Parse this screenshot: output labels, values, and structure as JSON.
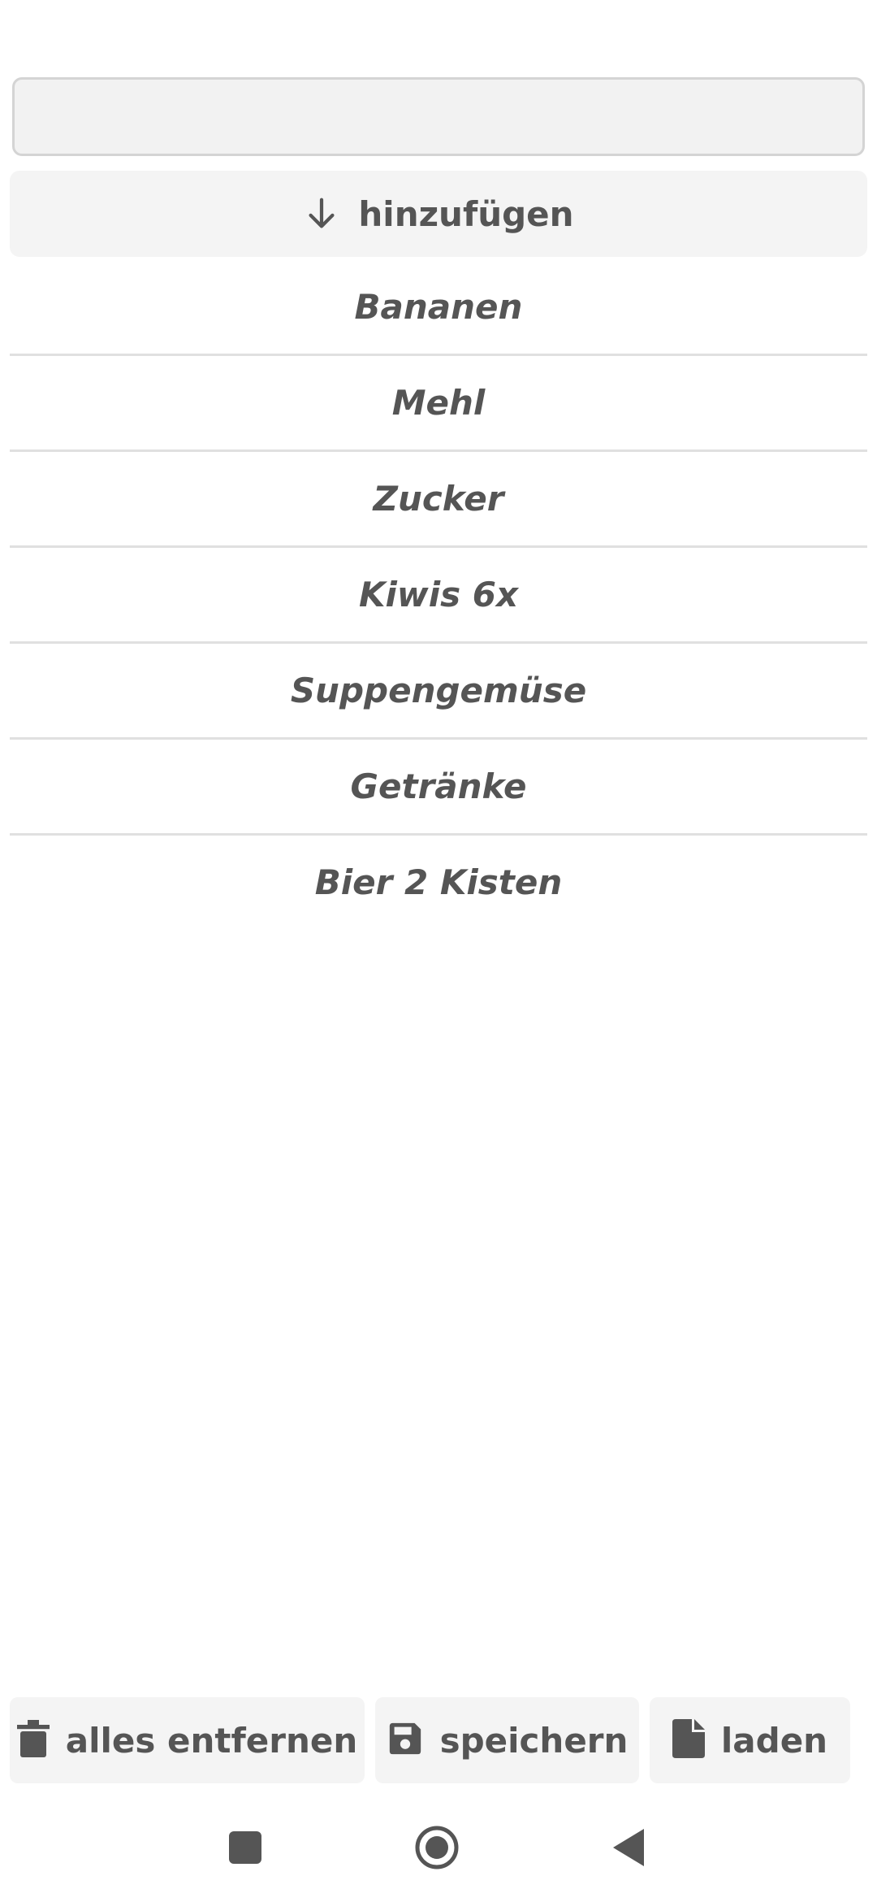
{
  "input": {
    "value": "",
    "placeholder": ""
  },
  "add_button": {
    "label": "hinzufügen",
    "icon": "arrow-down-icon"
  },
  "list": {
    "items": [
      "Bananen",
      "Mehl",
      "Zucker",
      "Kiwis 6x",
      "Suppengemüse",
      "Getränke",
      "Bier 2 Kisten"
    ]
  },
  "bottom_bar": {
    "clear_label": "alles entfernen",
    "clear_icon": "trash-icon",
    "save_label": "speichern",
    "save_icon": "floppy-disk-icon",
    "load_label": "laden",
    "load_icon": "file-icon"
  },
  "nav": {
    "recents_icon": "square-icon",
    "home_icon": "circle-icon",
    "back_icon": "triangle-back-icon"
  },
  "colors": {
    "text": "#555555",
    "button_bg": "#f4f4f4",
    "divider": "#e0e0e0"
  }
}
